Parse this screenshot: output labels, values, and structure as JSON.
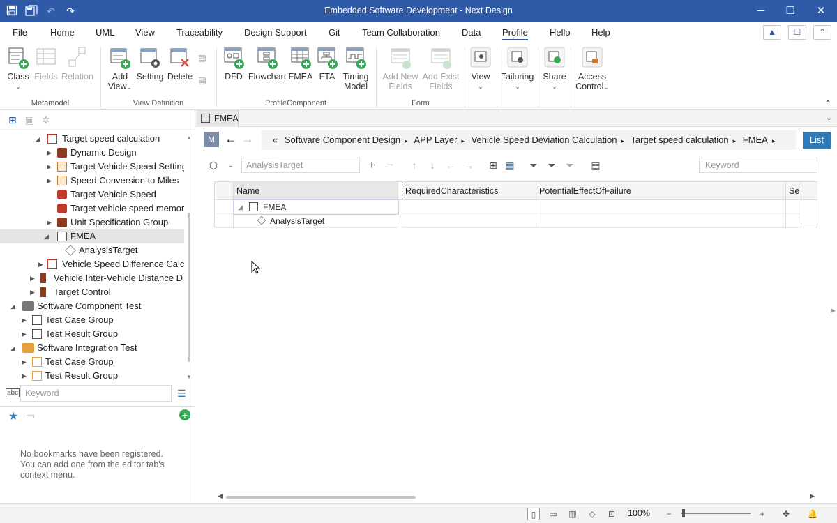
{
  "titlebar": {
    "title": "Embedded Software Development - Next Design"
  },
  "menu": {
    "items": [
      "File",
      "Home",
      "UML",
      "View",
      "Traceability",
      "Design Support",
      "Git",
      "Team Collaboration",
      "Data",
      "Profile",
      "Hello",
      "Help"
    ],
    "active": "Profile"
  },
  "ribbon": {
    "class": "Class",
    "fields": "Fields",
    "relation": "Relation",
    "metamodel": "Metamodel",
    "add_view_1": "Add",
    "add_view_2": "View",
    "setting": "Setting",
    "delete": "Delete",
    "view_definition": "View Definition",
    "dfd": "DFD",
    "flowchart": "Flowchart",
    "fmea": "FMEA",
    "fta": "FTA",
    "timing_1": "Timing",
    "timing_2": "Model",
    "profile_component": "ProfileComponent",
    "add_new_1": "Add New",
    "add_new_2": "Fields",
    "add_exist_1": "Add Exist",
    "add_exist_2": "Fields",
    "form": "Form",
    "view": "View",
    "tailoring": "Tailoring",
    "share": "Share",
    "access_1": "Access",
    "access_2": "Control"
  },
  "tree": {
    "items": [
      "Target speed calculation",
      "Dynamic Design",
      "Target Vehicle Speed Setting",
      "Speed Conversion to Miles",
      "Target Vehicle Speed",
      "Target vehicle speed memory",
      "Unit Specification Group",
      "FMEA",
      "AnalysisTarget",
      "Vehicle Speed Difference Calculation",
      "Vehicle Inter-Vehicle Distance D",
      "Target Control",
      "Software Component Test",
      "Test Case Group",
      "Test Result Group",
      "Software Integration Test",
      "Test Case Group",
      "Test Result Group"
    ]
  },
  "left_search": {
    "placeholder": "Keyword"
  },
  "bookmarks": {
    "line1": "No bookmarks have been registered.",
    "line2": "You can add one from the editor tab's",
    "line3": "context menu."
  },
  "doc_tab": {
    "label": "FMEA"
  },
  "editor": {
    "mode_badge": "M",
    "breadcrumb": [
      "«",
      "Software Component Design",
      "APP Layer",
      "Vehicle Speed Deviation Calculation",
      "Target speed calculation",
      "FMEA"
    ],
    "list_button": "List",
    "filter_placeholder": "AnalysisTarget",
    "keyword_placeholder": "Keyword",
    "columns": [
      "Name",
      "RequiredCharacteristics",
      "PotentialEffectOfFailure",
      "Se"
    ],
    "rows": [
      {
        "name": "FMEA"
      },
      {
        "name": "AnalysisTarget"
      }
    ]
  },
  "status": {
    "zoom": "100%"
  }
}
